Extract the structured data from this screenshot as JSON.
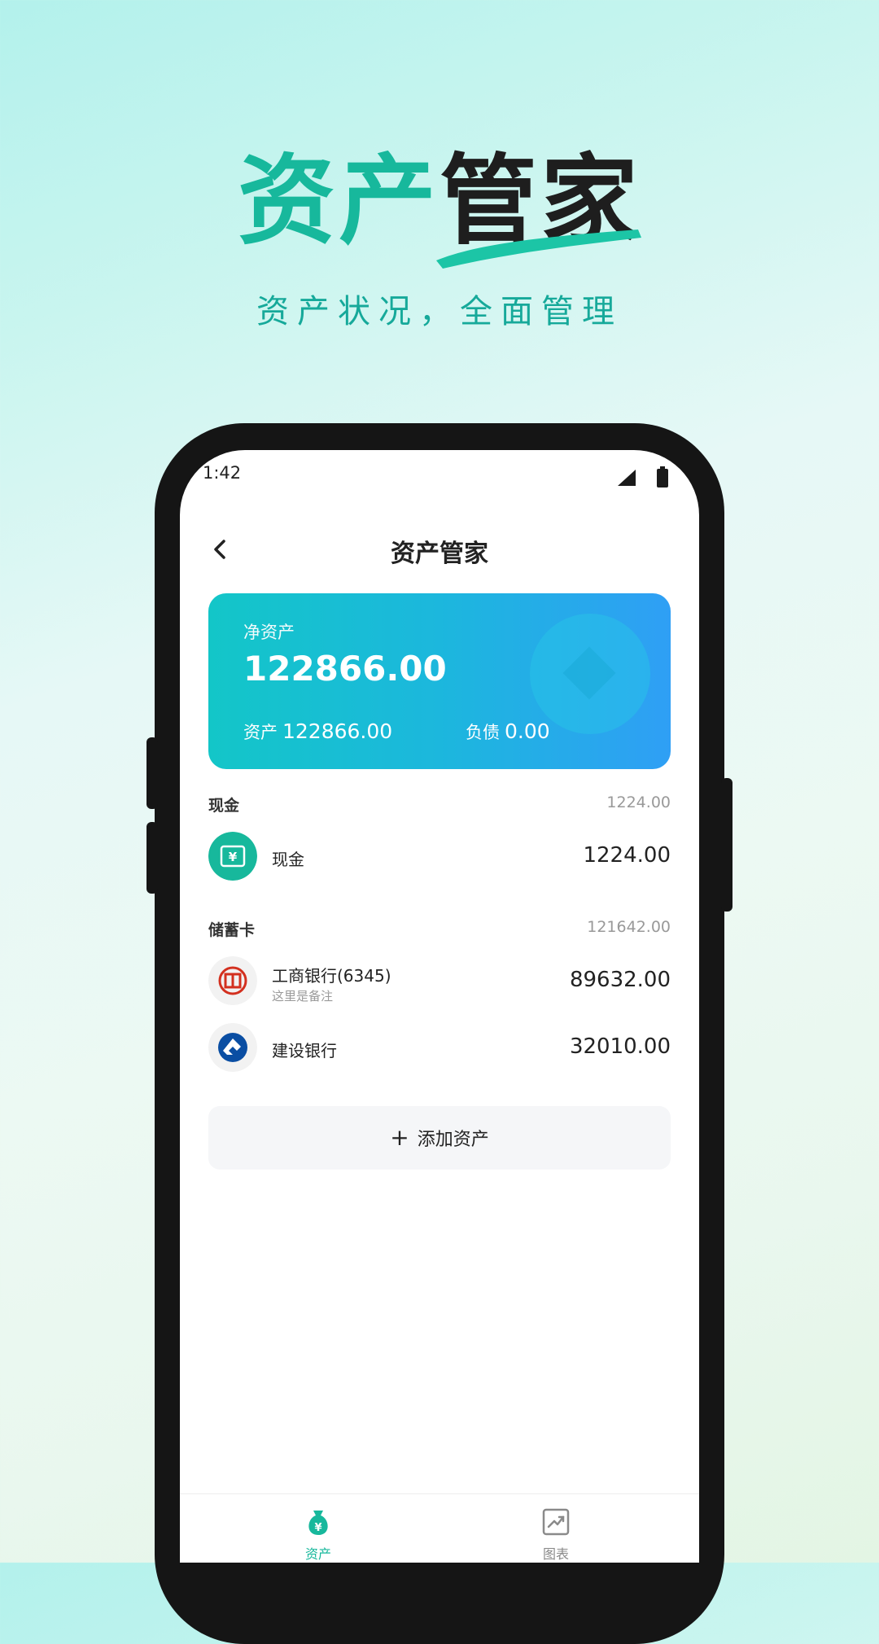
{
  "hero": {
    "title_part1": "资产",
    "title_part2": "管家",
    "subtitle": "资产状况，全面管理"
  },
  "status_bar": {
    "time": "1:42"
  },
  "nav": {
    "title": "资产管家",
    "back_icon": "chevron-left-icon"
  },
  "summary_card": {
    "net_label": "净资产",
    "net_value": "122866.00",
    "assets_label": "资产",
    "assets_value": "122866.00",
    "liabilities_label": "负债",
    "liabilities_value": "0.00"
  },
  "sections": [
    {
      "name": "现金",
      "total": "1224.00",
      "items": [
        {
          "name": "现金",
          "note": "",
          "amount": "1224.00",
          "icon": "cash-icon"
        }
      ]
    },
    {
      "name": "储蓄卡",
      "total": "121642.00",
      "items": [
        {
          "name": "工商银行(6345)",
          "note": "这里是备注",
          "amount": "89632.00",
          "icon": "icbc-bank-icon"
        },
        {
          "name": "建设银行",
          "note": "",
          "amount": "32010.00",
          "icon": "ccb-bank-icon"
        }
      ]
    }
  ],
  "add_button": {
    "label": "添加资产"
  },
  "tabbar": {
    "tabs": [
      {
        "label": "资产",
        "icon": "money-bag-icon",
        "active": true
      },
      {
        "label": "图表",
        "icon": "trend-chart-icon",
        "active": false
      }
    ]
  },
  "colors": {
    "accent": "#17b89c",
    "card_gradient_start": "#13c6c8",
    "card_gradient_end": "#2f9ff5"
  }
}
